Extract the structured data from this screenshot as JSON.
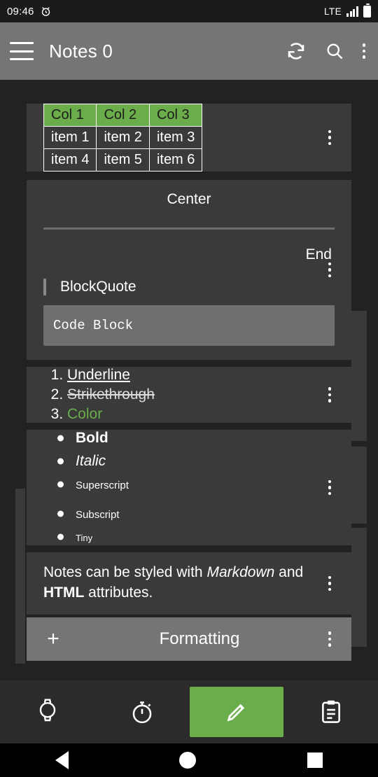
{
  "statusbar": {
    "clock": "09:46",
    "alarm_icon": "alarm-clock-icon",
    "network": "LTE",
    "signal_icon": "signal-bars-icon",
    "battery_icon": "battery-full-icon"
  },
  "appbar": {
    "menu_icon": "hamburger-menu-icon",
    "title": "Notes 0",
    "sync_icon": "sync-refresh-icon",
    "search_icon": "search-icon",
    "overflow_icon": "more-vertical-icon"
  },
  "note_cards": [
    {
      "id": "table-card",
      "type": "table",
      "table": {
        "headers": [
          "Col 1",
          "Col 2",
          "Col 3"
        ],
        "rows": [
          [
            "item 1",
            "item 2",
            "item 3"
          ],
          [
            "item 4",
            "item 5",
            "item 6"
          ]
        ],
        "header_bg": "#6aad4a"
      },
      "overflow_icon": "more-vertical-icon"
    },
    {
      "id": "alignment-card",
      "type": "alignment",
      "center_text": "Center",
      "end_text": "End",
      "blockquote_text": "BlockQuote",
      "code_block_text": "Code Block",
      "overflow_icon": "more-vertical-icon"
    },
    {
      "id": "ordered-list-card",
      "type": "ordered-list",
      "items": [
        {
          "label": "Underline",
          "style": "underline"
        },
        {
          "label": "Strikethrough",
          "style": "strikethrough"
        },
        {
          "label": "Color",
          "style": "color",
          "color": "#6aad4a"
        }
      ],
      "overflow_icon": "more-vertical-icon"
    },
    {
      "id": "bullet-list-card",
      "type": "bullet-list",
      "items": [
        {
          "label": "Bold",
          "style": "bold"
        },
        {
          "label": "Italic",
          "style": "italic"
        },
        {
          "label": "Superscript",
          "style": "superscript"
        },
        {
          "label": "Subscript",
          "style": "subscript"
        },
        {
          "label": "Tiny",
          "style": "tiny"
        }
      ],
      "overflow_icon": "more-vertical-icon"
    },
    {
      "id": "markdown-card",
      "type": "paragraph",
      "text_part_1": "Notes can be styled with ",
      "text_markdown": "Markdown",
      "text_part_2": " and ",
      "text_html": "HTML",
      "text_part_3": " attributes.",
      "overflow_icon": "more-vertical-icon"
    }
  ],
  "formatting_bar": {
    "add_icon": "plus-icon",
    "label": "Formatting",
    "overflow_icon": "more-vertical-icon"
  },
  "bottomnav": {
    "items": [
      {
        "name": "watch-tab",
        "icon": "watch-icon"
      },
      {
        "name": "timer-tab",
        "icon": "stopwatch-icon"
      },
      {
        "name": "edit-fab",
        "icon": "pencil-icon",
        "accent": "#6aad4a"
      },
      {
        "name": "clipboard-tab",
        "icon": "clipboard-icon"
      }
    ]
  },
  "navbar": {
    "back_icon": "back-triangle-icon",
    "home_icon": "home-circle-icon",
    "recents_icon": "recents-square-icon"
  },
  "colors": {
    "accent": "#6aad4a",
    "app_bar": "#757575",
    "card": "#3a3a3a",
    "page_bg": "#222222"
  }
}
